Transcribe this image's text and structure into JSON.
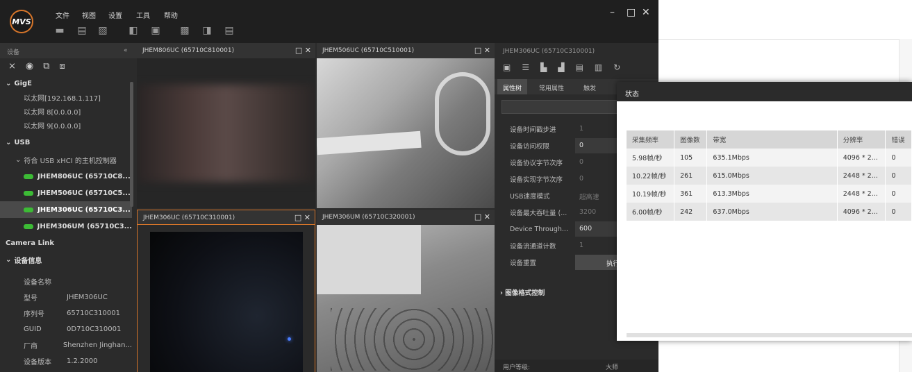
{
  "menu": {
    "file": "文件",
    "view": "视图",
    "settings": "设置",
    "tools": "工具",
    "help": "帮助"
  },
  "logo_text": "MVS",
  "window_controls": {
    "minimize": "–",
    "maximize": "□",
    "close": "✕"
  },
  "device_panel": {
    "title": "设备",
    "rows": [
      {
        "label": "GigE",
        "type": "section",
        "chevron": "⌄"
      },
      {
        "label": "以太网[192.168.1.117]",
        "type": "item"
      },
      {
        "label": "以太网 8[0.0.0.0]",
        "type": "item"
      },
      {
        "label": "以太网 9[0.0.0.0]",
        "type": "item"
      },
      {
        "label": "USB",
        "type": "section",
        "chevron": "⌄"
      },
      {
        "label": "符合 USB xHCI 的主机控制器",
        "type": "sub",
        "chevron": "⌄"
      },
      {
        "label": "JHEM806UC (65710C8...",
        "type": "camera"
      },
      {
        "label": "JHEM506UC (65710C5...",
        "type": "camera"
      },
      {
        "label": "JHEM306UC (65710C3...",
        "type": "camera",
        "selected": true
      },
      {
        "label": "JHEM306UM (65710C3...",
        "type": "camera"
      },
      {
        "label": "Camera Link",
        "type": "section"
      },
      {
        "label": "设备信息",
        "type": "section",
        "chevron": "⌄"
      }
    ],
    "info": [
      {
        "k": "设备名称",
        "v": ""
      },
      {
        "k": "型号",
        "v": "JHEM306UC"
      },
      {
        "k": "序列号",
        "v": "65710C310001"
      },
      {
        "k": "GUID",
        "v": "0D710C310001"
      },
      {
        "k": "厂商",
        "v": "Shenzhen Jinghan..."
      },
      {
        "k": "设备版本",
        "v": "1.2.2000"
      }
    ]
  },
  "views": [
    {
      "title": "JHEM806UC (65710C810001)"
    },
    {
      "title": "JHEM506UC (65710C510001)"
    },
    {
      "title": "JHEM306UC (65710C310001)"
    },
    {
      "title": "JHEM306UM (65710C320001)"
    }
  ],
  "properties": {
    "title": "JHEM306UC (65710C310001)",
    "tabs": [
      "属性树",
      "常用属性",
      "触发"
    ],
    "rows": [
      {
        "k": "设备时间戳步进",
        "v": "1",
        "enabled": false
      },
      {
        "k": "设备访问权限",
        "v": "0",
        "enabled": true
      },
      {
        "k": "设备协议字节次序",
        "v": "0",
        "enabled": false
      },
      {
        "k": "设备实现字节次序",
        "v": "0",
        "enabled": false
      },
      {
        "k": "USB速度模式",
        "v": "超高速",
        "enabled": false
      },
      {
        "k": "设备最大吞吐量 (...",
        "v": "3200",
        "enabled": false
      },
      {
        "k": "Device Through...",
        "v": "600",
        "enabled": true
      },
      {
        "k": "设备流通道计数",
        "v": "1",
        "enabled": false
      },
      {
        "k": "设备重置",
        "v": "执行",
        "enabled": true,
        "button": true
      }
    ],
    "group": "图像格式控制",
    "user_level_label": "用户等级:",
    "user_level": "大师"
  },
  "status_dialog": {
    "title": "状态",
    "columns": [
      "采集频率",
      "图像数",
      "带宽",
      "分辨率",
      "错误"
    ],
    "rows": [
      [
        "5.98帧/秒",
        "105",
        "635.1Mbps",
        "4096 * 2...",
        "0"
      ],
      [
        "10.22帧/秒",
        "261",
        "615.0Mbps",
        "2448 * 2...",
        "0"
      ],
      [
        "10.19帧/秒",
        "361",
        "613.3Mbps",
        "2448 * 2...",
        "0"
      ],
      [
        "6.00帧/秒",
        "242",
        "637.0Mbps",
        "4096 * 2...",
        "0"
      ]
    ]
  }
}
